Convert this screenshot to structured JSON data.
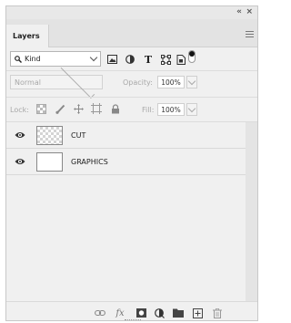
{
  "panel": {
    "collapse_glyph": "«",
    "close_glyph": "×",
    "tab_label": "Layers"
  },
  "filter": {
    "kind_label": "Kind",
    "icons": [
      "image-filter-icon",
      "adjustment-filter-icon",
      "type-filter-icon",
      "shape-filter-icon",
      "smart-object-filter-icon"
    ],
    "type_glyph": "T"
  },
  "blending": {
    "mode": "Normal",
    "opacity_label": "Opacity:",
    "opacity_value": "100%"
  },
  "lock": {
    "label": "Lock:",
    "fill_label": "Fill:",
    "fill_value": "100%"
  },
  "layers": [
    {
      "name": "CUT",
      "visible": true,
      "thumbnail": "transparent"
    },
    {
      "name": "GRAPHICS",
      "visible": true,
      "thumbnail": "white"
    }
  ],
  "footer": {
    "fx_label": "fx"
  },
  "colors": {
    "panel_bg": "#f0f0f0",
    "tab_bar": "#e3e3e3"
  }
}
